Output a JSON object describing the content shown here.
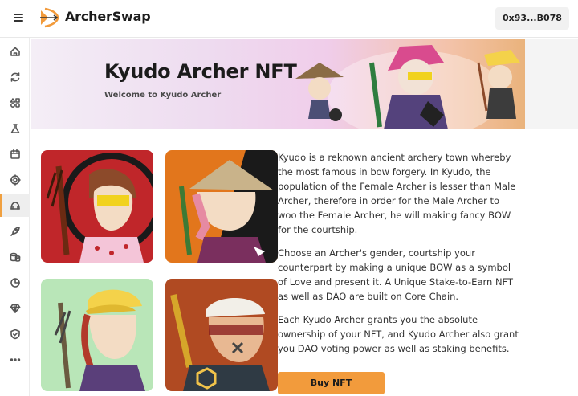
{
  "header": {
    "brand": "ArcherSwap",
    "wallet_address": "0x93...B078",
    "icons": [
      "hamburger-menu-icon",
      "archerswap-logo-icon"
    ]
  },
  "sidebar": {
    "items": [
      {
        "name": "home",
        "icon": "home-icon",
        "active": false
      },
      {
        "name": "swap",
        "icon": "refresh-icon",
        "active": false
      },
      {
        "name": "liquidity",
        "icon": "shapes-icon",
        "active": false
      },
      {
        "name": "farms",
        "icon": "flask-icon",
        "active": false
      },
      {
        "name": "pools",
        "icon": "calendar-icon",
        "active": false
      },
      {
        "name": "lottery",
        "icon": "target-icon",
        "active": false
      },
      {
        "name": "nft",
        "icon": "archer-bow-icon",
        "active": true
      },
      {
        "name": "launchpad",
        "icon": "rocket-icon",
        "active": false
      },
      {
        "name": "staking",
        "icon": "coins-icon",
        "active": false
      },
      {
        "name": "analytics",
        "icon": "pie-chart-icon",
        "active": false
      },
      {
        "name": "vault",
        "icon": "diamond-icon",
        "active": false
      },
      {
        "name": "security",
        "icon": "shield-check-icon",
        "active": false
      },
      {
        "name": "more",
        "icon": "more-icon",
        "active": false
      }
    ]
  },
  "hero": {
    "title": "Kyudo Archer NFT",
    "subtitle": "Welcome to Kyudo Archer"
  },
  "description": {
    "p1": "Kyudo is a reknown ancient archery town whereby the most famous in bow forgery. In Kyudo, the population of the Female Archer is lesser than Male Archer, therefore in order for the Male Archer to woo the Female Archer, he will making fancy BOW for the courtship.",
    "p2": "Choose an Archer's gender, courtship your counterpart by making a unique BOW as a symbol of Love and present it. A Unique Stake-to-Earn NFT as well as DAO are built on Core Chain.",
    "p3": "Each Kyudo Archer grants you the absolute ownership of your NFT, and Kyudo Archer also grant you DAO voting power as well as staking benefits."
  },
  "buy_button": "Buy NFT",
  "colors": {
    "accent": "#f29b3c",
    "card_red": "#c0262a",
    "card_orange": "#e2761c",
    "card_green": "#b9e6b8",
    "card_rust": "#b04a22"
  }
}
